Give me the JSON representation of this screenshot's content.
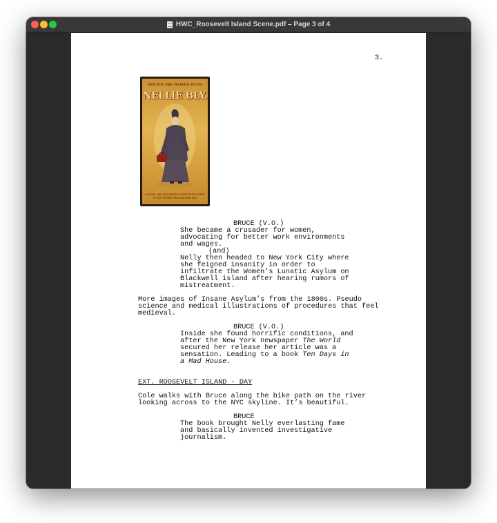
{
  "window": {
    "title": "HWC_Roosevelt Island Scene.pdf – Page 3 of 4"
  },
  "page": {
    "page_number": "3.",
    "poster": {
      "top_text": "ROUND THE WORLD WITH",
      "name": "NELLIE BLY.",
      "bottom_text": "A NOVEL AND FASCINATING GAME WITH PLENTY OF EXCITEMENT ON LAND AND SEA."
    },
    "lines": [
      "BRUCE (V.O.)",
      "She became a crusader for women,",
      "advocating for better work environments",
      "and wages.",
      "(and)",
      "Nelly then headed to New York City where",
      "she feigned insanity in order to",
      "infiltrate the Women’s Lunatic Asylum on",
      "Blackwell island after hearing rumors of",
      "mistreatment.",
      "More images of Insane Asylum’s from the 1800s. Pseudo",
      "science and medical illustrations of procedures that feel",
      "medieval.",
      "BRUCE (V.O.)",
      "Inside she found horrific conditions, and",
      "after the New York newspaper ",
      "The World",
      "secured her release her article was a",
      "sensation. Leading to a book ",
      "Ten Days in",
      "a Mad House",
      ".",
      "EXT. ROOSEVELT ISLAND - DAY",
      "Cole walks with Bruce along the bike path on the river",
      "looking across to the NYC skyline. It’s beautiful.",
      "BRUCE",
      "The book brought Nelly everlasting fame",
      "and basically invented investigative",
      "journalism."
    ]
  }
}
